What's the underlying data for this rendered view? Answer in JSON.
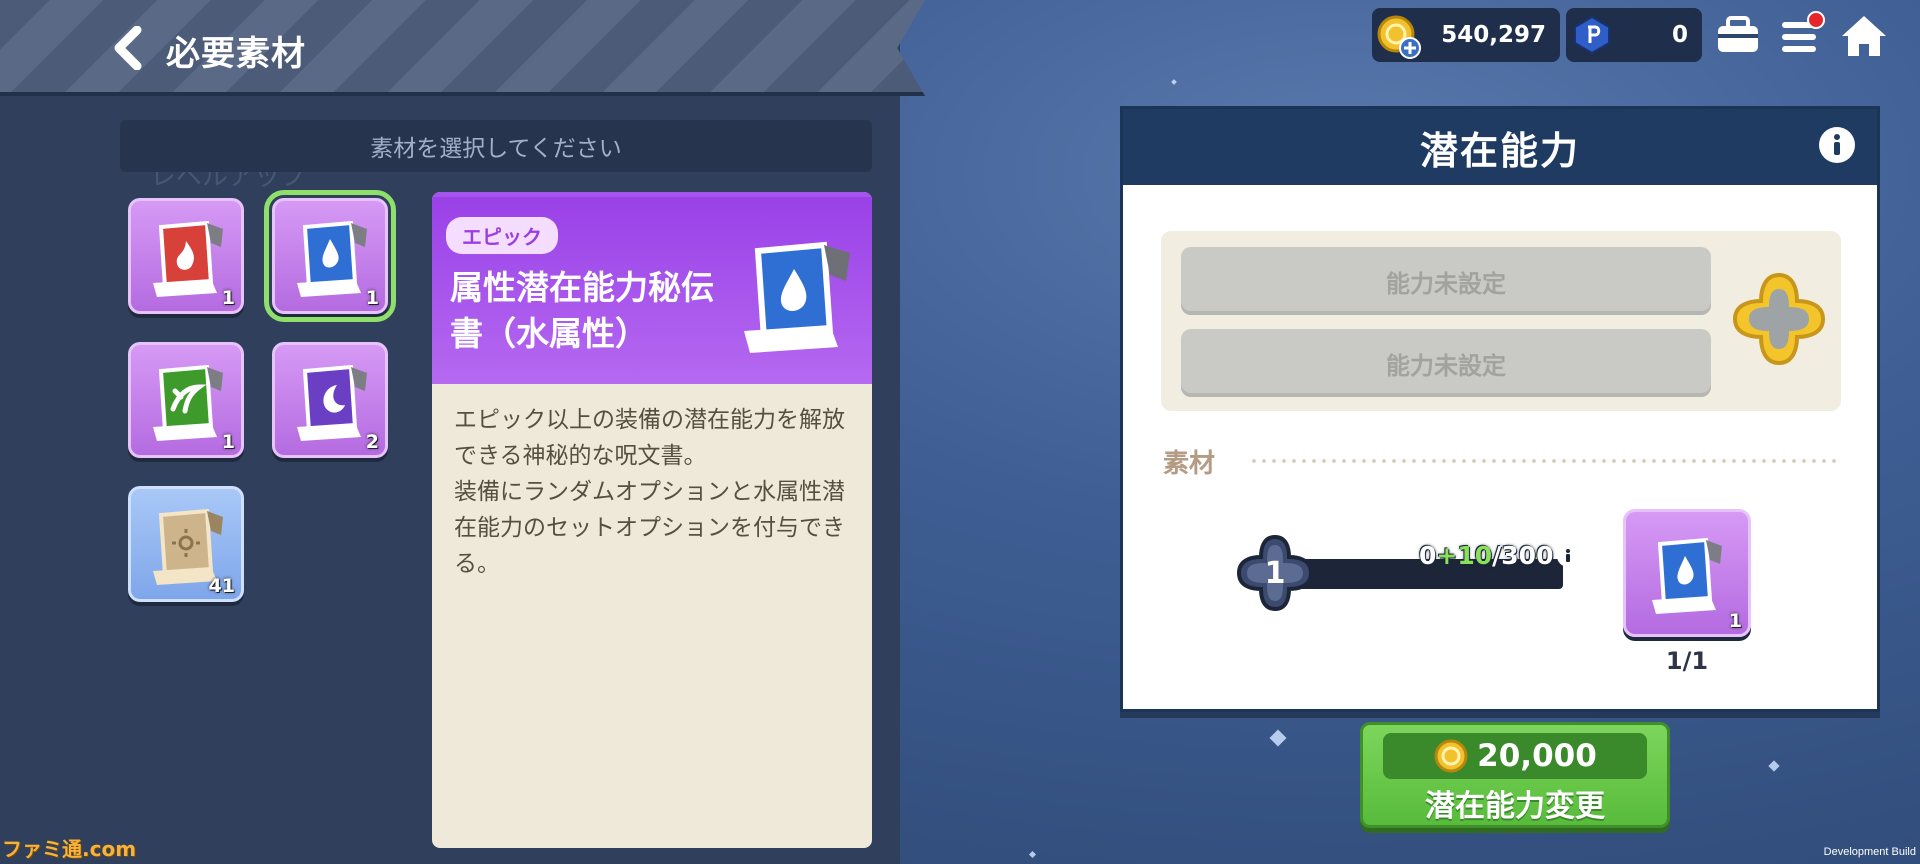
{
  "header": {
    "title": "必要素材"
  },
  "left": {
    "select_prompt": "素材を選択してください",
    "ghost_text": "レベルアップ"
  },
  "items": [
    {
      "name": "fire-scroll",
      "count": "1",
      "color": "#d8403a",
      "symbol": "flame-icon"
    },
    {
      "name": "water-scroll",
      "count": "1",
      "color": "#2f6fd4",
      "symbol": "water-drop-icon"
    },
    {
      "name": "wind-scroll",
      "count": "1",
      "color": "#3f9a2c",
      "symbol": "leaf-icon"
    },
    {
      "name": "dark-scroll",
      "count": "2",
      "color": "#6a3fc4",
      "symbol": "moon-icon"
    },
    {
      "name": "plain-scroll",
      "count": "41",
      "color": "#cdb48a",
      "symbol": "sun-icon"
    }
  ],
  "detail": {
    "rarity": "エピック",
    "name": "属性潜在能力秘伝書（水属性）",
    "description": "エピック以上の装備の潜在能力を解放できる神秘的な呪文書。\n装備にランダムオプションと水属性潜在能力のセットオプションを付与できる。"
  },
  "hud": {
    "gold": "540,297",
    "points": "0",
    "has_notification": true
  },
  "potential": {
    "title": "潜在能力",
    "slot1": "能力未設定",
    "slot2": "能力未設定",
    "material_label": "素材",
    "level": "1",
    "exp_current": "0",
    "exp_gain": "+10",
    "exp_max": "/300",
    "material_count": "1",
    "material_ratio": "1/1"
  },
  "action": {
    "cost": "20,000",
    "label": "潜在能力変更"
  },
  "footer": {
    "build": "Development Build",
    "watermark": "ファミ通.com"
  },
  "colors": {
    "accent_purple": "#a454ec",
    "accent_green": "#58bb3b",
    "panel_navy": "#1f3b62"
  }
}
